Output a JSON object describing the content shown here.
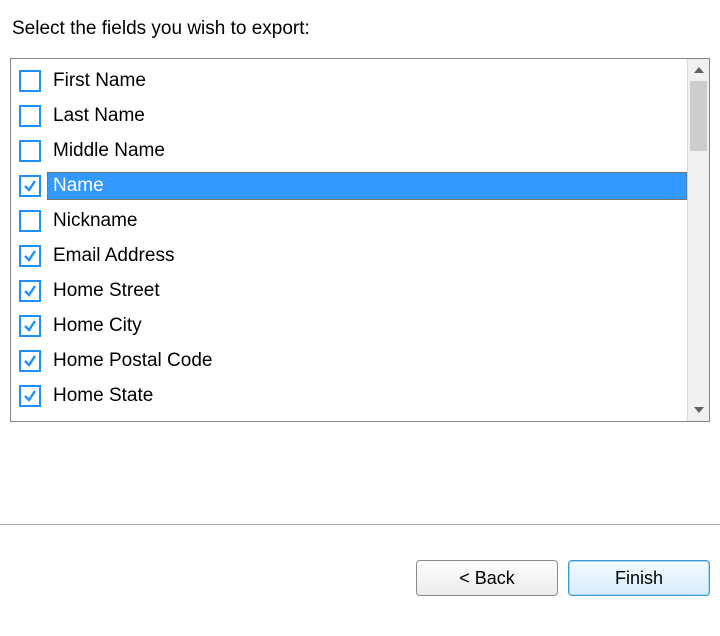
{
  "instruction": "Select the fields you wish to export:",
  "fields": [
    {
      "label": "First Name",
      "checked": false,
      "selected": false
    },
    {
      "label": "Last Name",
      "checked": false,
      "selected": false
    },
    {
      "label": "Middle Name",
      "checked": false,
      "selected": false
    },
    {
      "label": "Name",
      "checked": true,
      "selected": true
    },
    {
      "label": "Nickname",
      "checked": false,
      "selected": false
    },
    {
      "label": "Email Address",
      "checked": true,
      "selected": false
    },
    {
      "label": "Home Street",
      "checked": true,
      "selected": false
    },
    {
      "label": "Home City",
      "checked": true,
      "selected": false
    },
    {
      "label": "Home Postal Code",
      "checked": true,
      "selected": false
    },
    {
      "label": "Home State",
      "checked": true,
      "selected": false
    }
  ],
  "buttons": {
    "back": "< Back",
    "finish": "Finish"
  }
}
